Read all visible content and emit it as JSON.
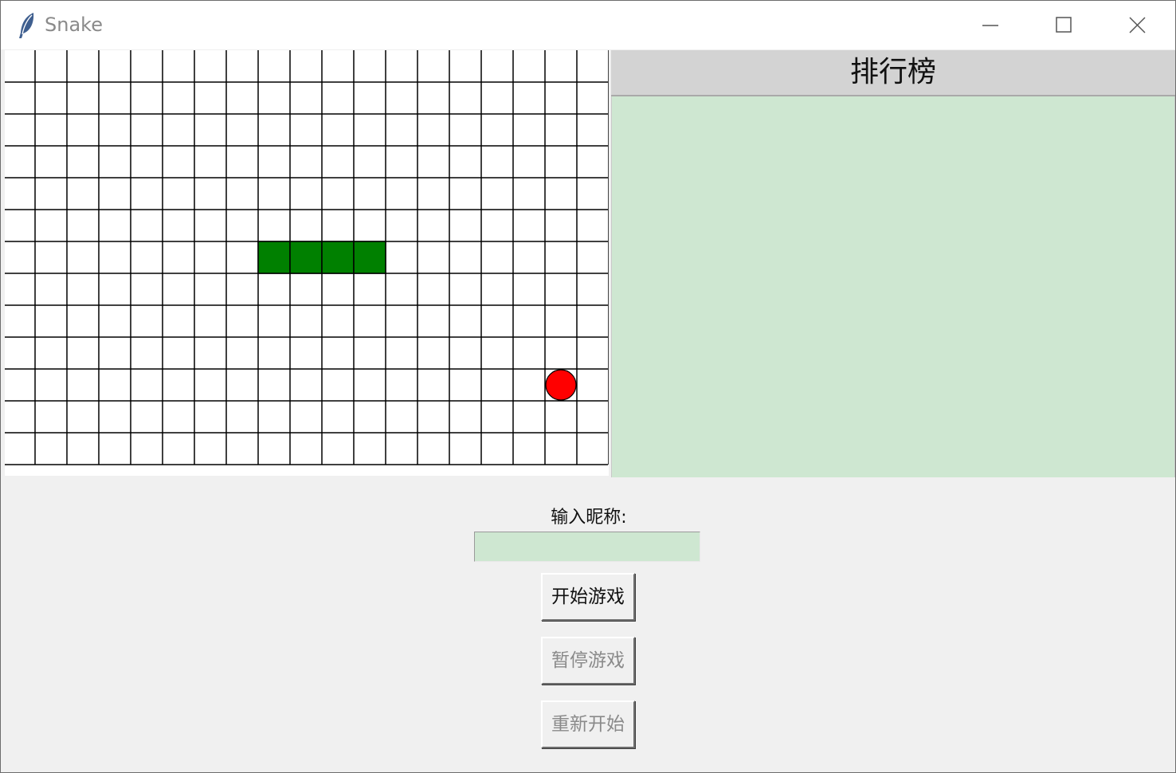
{
  "window": {
    "title": "Snake",
    "icon": "feather-icon",
    "controls": [
      "minimize-icon",
      "maximize-icon",
      "close-icon"
    ]
  },
  "board": {
    "columns": 19,
    "rows": 13,
    "grid_color": "#000000",
    "snake_color": "#008000",
    "food_color": "#ff0000",
    "snake": [
      [
        8,
        6
      ],
      [
        9,
        6
      ],
      [
        10,
        6
      ],
      [
        11,
        6
      ]
    ],
    "food": [
      17,
      10
    ]
  },
  "leaderboard": {
    "title": "排行榜",
    "entries": []
  },
  "controls": {
    "nickname_label": "输入昵称:",
    "nickname_value": "",
    "start_label": "开始游戏",
    "pause_label": "暂停游戏",
    "restart_label": "重新开始"
  },
  "colors": {
    "panel_green": "#cee7d1",
    "header_gray": "#d3d3d3",
    "disabled_text": "#8a8a8a"
  }
}
